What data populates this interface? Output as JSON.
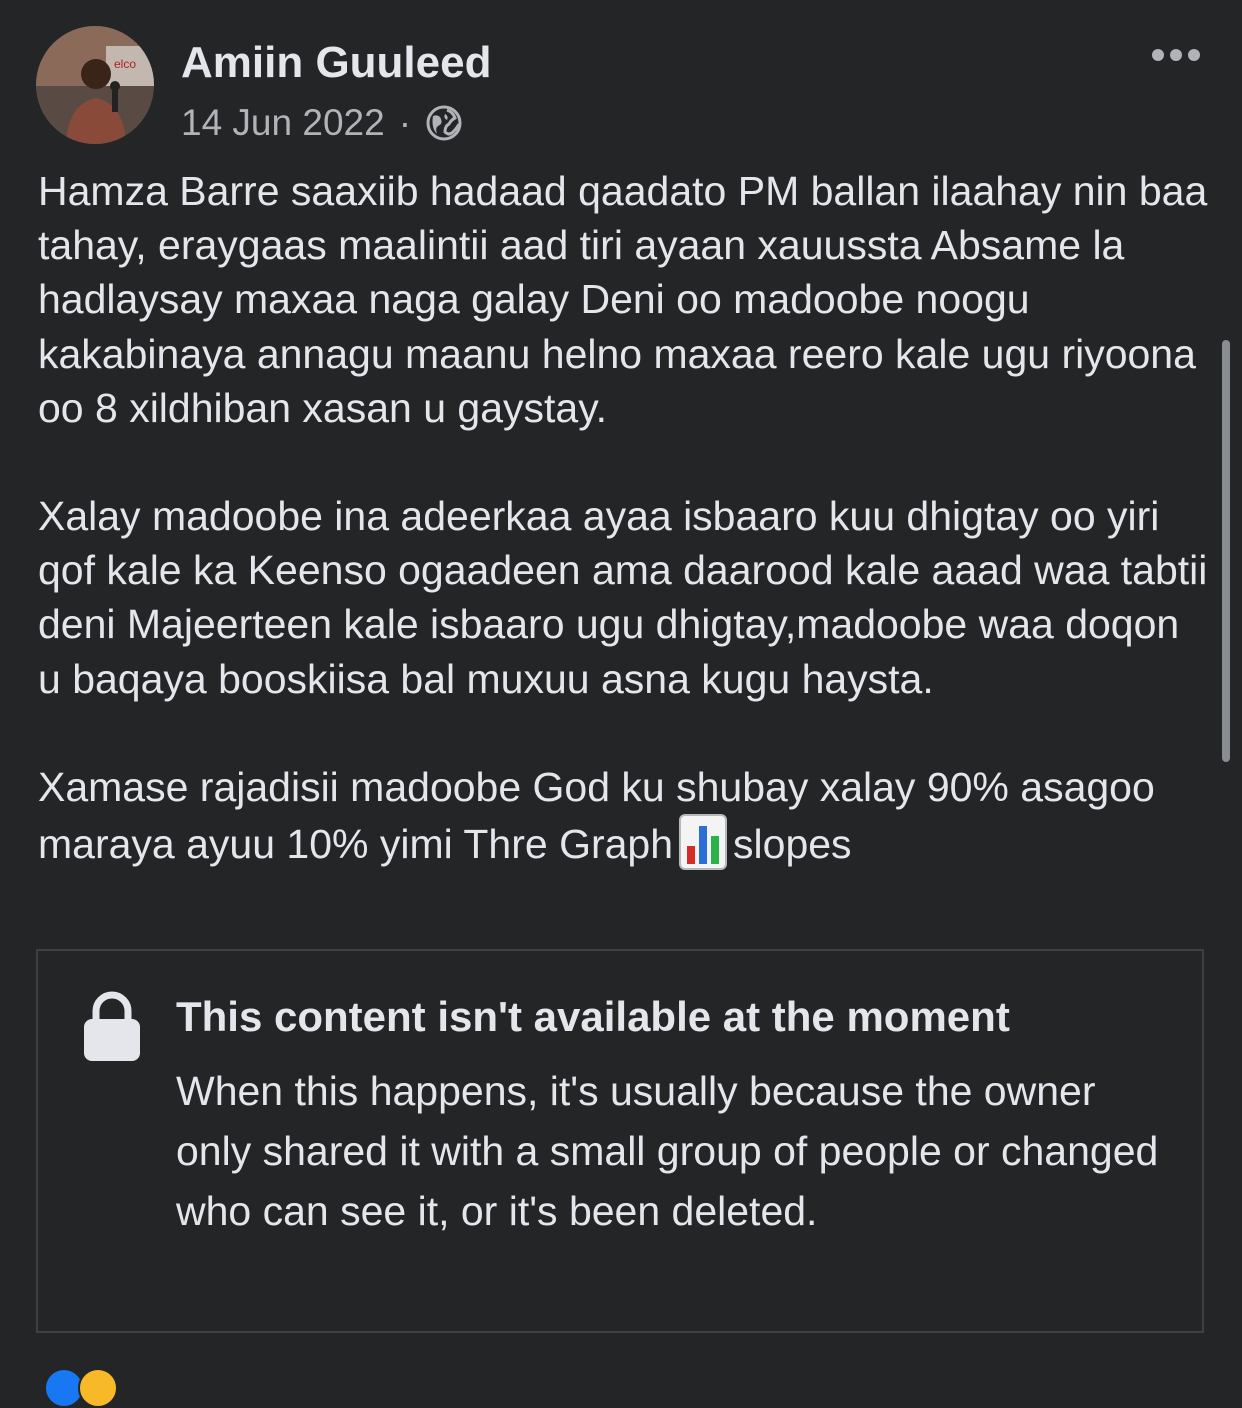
{
  "post": {
    "author": "Amiin Guuleed",
    "date": "14 Jun 2022",
    "separator": "·",
    "privacy_icon": "globe-icon",
    "more_icon": "more-options-icon",
    "paragraphs": [
      "Hamza Barre  saaxiib hadaad qaadato PM ballan ilaahay nin baa tahay, eraygaas maalintii aad tiri ayaan xauussta Absame la hadlaysay maxaa naga galay Deni oo madoobe noogu kakabinaya annagu maanu helno maxaa reero kale ugu riyoona oo 8 xildhiban xasan u gaystay.",
      "Xalay madoobe ina adeerkaa ayaa isbaaro kuu dhigtay oo yiri qof kale ka Keenso ogaadeen ama daarood kale aaad waa tabtii deni Majeerteen kale isbaaro ugu dhigtay,madoobe waa doqon u baqaya booskiisa bal muxuu asna kugu haysta."
    ],
    "last_paragraph_before_emoji": "Xamase rajadisii madoobe God ku shubay xalay 90% asagoo maraya ayuu 10% yimi Thre Graph",
    "last_paragraph_emoji": "bar-chart-emoji-icon",
    "last_paragraph_after_emoji": "slopes"
  },
  "shared_content": {
    "lock_icon": "lock-icon",
    "title": "This content isn't available at the moment",
    "body": "When this happens, it's usually because the owner only shared it with a small group of people or changed who can see it, or it's been deleted."
  },
  "colors": {
    "background": "#242527",
    "text_primary": "#e4e6eb",
    "text_secondary": "#b0b3b8",
    "border": "#3e4042"
  }
}
